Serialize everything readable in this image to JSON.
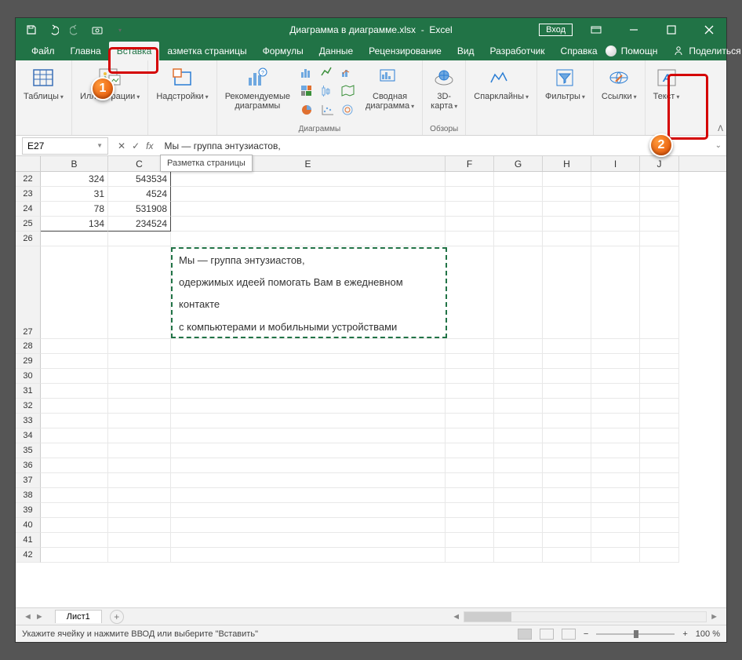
{
  "title": {
    "filename": "Диаграмма в диаграмме.xlsx",
    "app": "Excel",
    "login": "Вход"
  },
  "tabs": {
    "file": "Файл",
    "home": "Главна",
    "insert": "Вставка",
    "layout": "азметка страницы",
    "formulas": "Формулы",
    "data": "Данные",
    "review": "Рецензирование",
    "view": "Вид",
    "developer": "Разработчик",
    "help": "Справка",
    "helpHint": "Помощн",
    "share": "Поделиться"
  },
  "ribbon": {
    "tables": "Таблицы",
    "illustrations": "Иллюстрации",
    "addins": "Надстройки",
    "recCharts": "Рекомендуемые\nдиаграммы",
    "chartsGroup": "Диаграммы",
    "pivotChart": "Сводная\nдиаграмма",
    "map3d": "3D-\nкарта",
    "tours": "Обзоры",
    "sparklines": "Спарклайны",
    "filters": "Фильтры",
    "links": "Ссылки",
    "text": "Текст"
  },
  "tooltip": "Разметка страницы",
  "formulaBar": {
    "nameBox": "E27",
    "formula": "Мы — группа энтузиастов,"
  },
  "columns": [
    "B",
    "C",
    "E",
    "F",
    "G",
    "H",
    "I",
    "J"
  ],
  "colWidths": {
    "B": 86,
    "C": 80,
    "D": 0,
    "E": 350,
    "F": 62,
    "G": 62,
    "H": 62,
    "I": 62,
    "J": 50
  },
  "rows": [
    {
      "n": 22,
      "B": "324",
      "C": "543534"
    },
    {
      "n": 23,
      "B": "31",
      "C": "4524"
    },
    {
      "n": 24,
      "B": "78",
      "C": "531908"
    },
    {
      "n": 25,
      "B": "134",
      "C": "234524"
    },
    {
      "n": 26
    },
    {
      "n": 27,
      "tall": true
    },
    {
      "n": 28
    },
    {
      "n": 29
    },
    {
      "n": 30
    },
    {
      "n": 31
    },
    {
      "n": 32
    },
    {
      "n": 33
    },
    {
      "n": 34
    },
    {
      "n": 35
    },
    {
      "n": 36
    },
    {
      "n": 37
    },
    {
      "n": 38
    },
    {
      "n": 39
    },
    {
      "n": 40
    },
    {
      "n": 41
    },
    {
      "n": 42
    }
  ],
  "textbox": {
    "line1": "Мы — группа энтузиастов,",
    "line2": "одержимых идеей помогать Вам в ежедневном",
    "line3": "контакте",
    "line4": "с компьютерами и мобильными устройствами"
  },
  "sheet": {
    "name": "Лист1"
  },
  "status": {
    "msg": "Укажите ячейку и нажмите ВВОД или выберите \"Вставить\"",
    "zoom": "100 %"
  },
  "annotations": {
    "a1": "1",
    "a2": "2"
  }
}
